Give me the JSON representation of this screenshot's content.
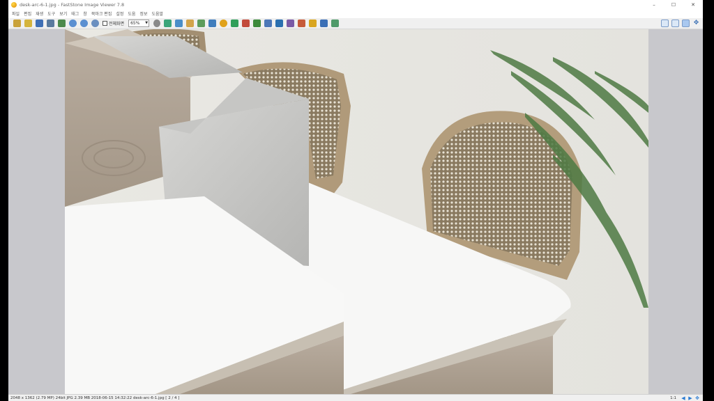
{
  "window": {
    "title": "desk-arc-6-1.jpg - FastStone Image Viewer 7.8",
    "controls": [
      "–",
      "☐",
      "✕"
    ]
  },
  "menu": [
    "파일",
    "편집",
    "재생",
    "도구",
    "보기",
    "태그",
    "창",
    "북마크 편집",
    "설정",
    "도움",
    "정보",
    "도움말"
  ],
  "toolbar": {
    "checkbox_label": "전체화면",
    "zoom_value": "65%",
    "icons": [
      "open-folder-icon",
      "browse-icon",
      "save-icon",
      "print-icon",
      "copy-icon",
      "zoom-in-icon",
      "zoom-out-icon",
      "fit-icon"
    ],
    "icons2": [
      "crop-icon",
      "resize-icon",
      "rotate-left-icon",
      "rotate-right-icon",
      "flip-icon",
      "color-icon",
      "effects-icon",
      "red-eye-icon",
      "levels-icon",
      "curves-icon",
      "sharpen-icon",
      "text-icon",
      "email-icon",
      "slideshow-icon",
      "compare-icon",
      "settings-icon"
    ],
    "right_icons": [
      "browser-view-icon",
      "fullscreen-view-icon",
      "windowed-view-icon",
      "fit-window-icon"
    ]
  },
  "statusbar": {
    "info": "2048 x 1362 (2.79 MP)  24bit  JPG  2.39 MB  2018-06-15 14:32:22  desk-arc-6-1.jpg [ 2 / 4 ]",
    "zoom": "1:1"
  },
  "colors": {
    "window_bg": "#ffffff",
    "toolbar_bg": "#f0f0f0",
    "viewer_bg": "#c8c8cc"
  }
}
